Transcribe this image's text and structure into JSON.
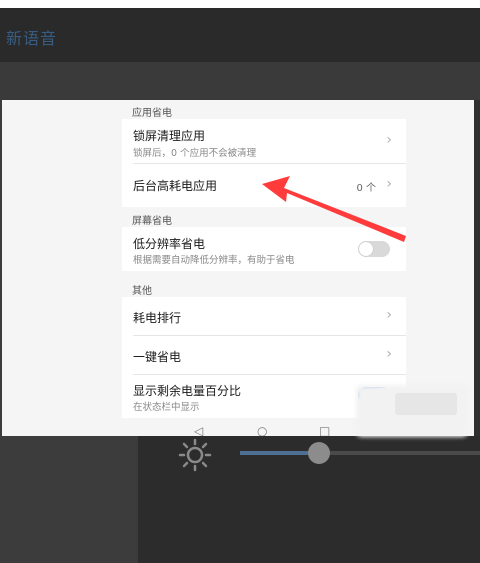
{
  "background_app": {
    "title": "新语音"
  },
  "sections": [
    {
      "header": "应用省电",
      "items": [
        {
          "title": "锁屏清理应用",
          "subtitle": "锁屏后，0 个应用不会被清理"
        },
        {
          "title": "后台高耗电应用",
          "value": "0 个"
        }
      ]
    },
    {
      "header": "屏幕省电",
      "items": [
        {
          "title": "低分辨率省电",
          "subtitle": "根据需要自动降低分辨率，有助于省电",
          "toggle": false
        }
      ]
    },
    {
      "header": "其他",
      "items": [
        {
          "title": "耗电排行"
        },
        {
          "title": "一键省电"
        },
        {
          "title": "显示剩余电量百分比",
          "subtitle": "在状态栏中显示",
          "toggle": true
        }
      ]
    }
  ],
  "navbar_icons": [
    "back-icon",
    "home-icon",
    "recents-icon"
  ],
  "brightness_level": 0.33,
  "colors": {
    "accent": "#2a7de1",
    "annotation_arrow": "#ff3b3b"
  }
}
